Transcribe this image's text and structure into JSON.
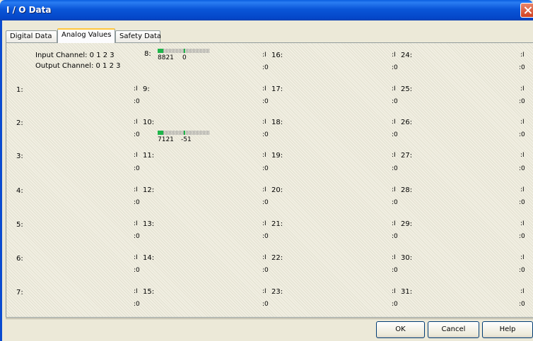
{
  "window": {
    "title": "I / O Data"
  },
  "tabs": [
    {
      "label": "Digital Data"
    },
    {
      "label": "Analog Values"
    },
    {
      "label": "Safety Data"
    }
  ],
  "legend": {
    "input": "Input Channel:  0 1 2 3",
    "output": "Output Channel: 0 1 2 3"
  },
  "channels": {
    "c0": "1:",
    "c1": "2:",
    "c2": "3:",
    "c3": "4:",
    "c4": "5:",
    "c5": "6:",
    "c6": "7:",
    "c8": "8:",
    "c9": "9:",
    "c10": "10:",
    "c11": "11:",
    "c12": "12:",
    "c13": "13:",
    "c14": "14:",
    "c15": "15:",
    "c16": "16:",
    "c17": "17:",
    "c18": "18:",
    "c19": "19:",
    "c20": "20:",
    "c21": "21:",
    "c22": "22:",
    "c23": "23:",
    "c24": "24:",
    "c25": "25:",
    "c26": "26:",
    "c27": "27:",
    "c28": "28:",
    "c29": "29:",
    "c30": "30:",
    "c31": "31:"
  },
  "markers": {
    "io": ":I",
    "zero": ":0"
  },
  "analog": {
    "ch8": {
      "value_a": "8821",
      "value_b": "0"
    },
    "ch10": {
      "value_a": "7121",
      "value_b": "-51"
    }
  },
  "buttons": {
    "ok": "OK",
    "cancel": "Cancel",
    "help": "Help"
  },
  "colors": {
    "titlebar": "#0a56d8",
    "bar_green": "#1fb54a",
    "tab_highlight": "#ffc73c"
  }
}
